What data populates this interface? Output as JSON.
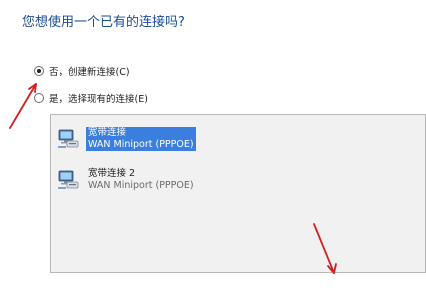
{
  "question": "您想使用一个已有的连接吗?",
  "options": [
    {
      "label": "否，创建新连接(C)",
      "checked": true
    },
    {
      "label": "是，选择现有的连接(E)",
      "checked": false
    }
  ],
  "connections": [
    {
      "name": "宽带连接",
      "device": "WAN Miniport (PPPOE)",
      "selected": true,
      "icon": "network-connection-icon"
    },
    {
      "name": "宽带连接 2",
      "device": "WAN Miniport (PPPOE)",
      "selected": false,
      "icon": "network-connection-icon"
    }
  ],
  "colors": {
    "question": "#1a4c96",
    "selection": "#3a7ede",
    "annotation_arrow": "#d21f1f"
  }
}
